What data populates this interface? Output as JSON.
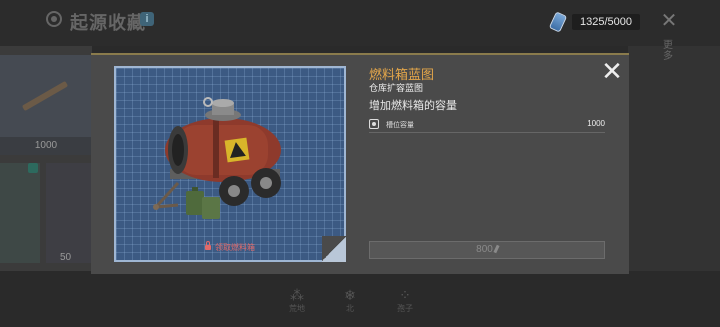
{
  "background": {
    "title": "起源收藏",
    "currency": "1325/5000",
    "card_prices": [
      "1000",
      "50"
    ],
    "side_text": "更多",
    "nav": [
      {
        "icon": "grass-icon",
        "label": "荒地"
      },
      {
        "icon": "snowflake-icon",
        "label": "北"
      },
      {
        "icon": "spores-icon",
        "label": "孢子"
      }
    ]
  },
  "modal": {
    "title": "燃料箱蓝图",
    "subtitle": "仓库扩容蓝图",
    "description": "增加燃料箱的容量",
    "stat": {
      "label": "槽位容量",
      "value": "1000"
    },
    "footer": "领取燃料箱",
    "button_label": "800"
  },
  "colors": {
    "title": "#e3a64a",
    "blueprint": "#3c5a83",
    "warning": "#e06a6a"
  }
}
